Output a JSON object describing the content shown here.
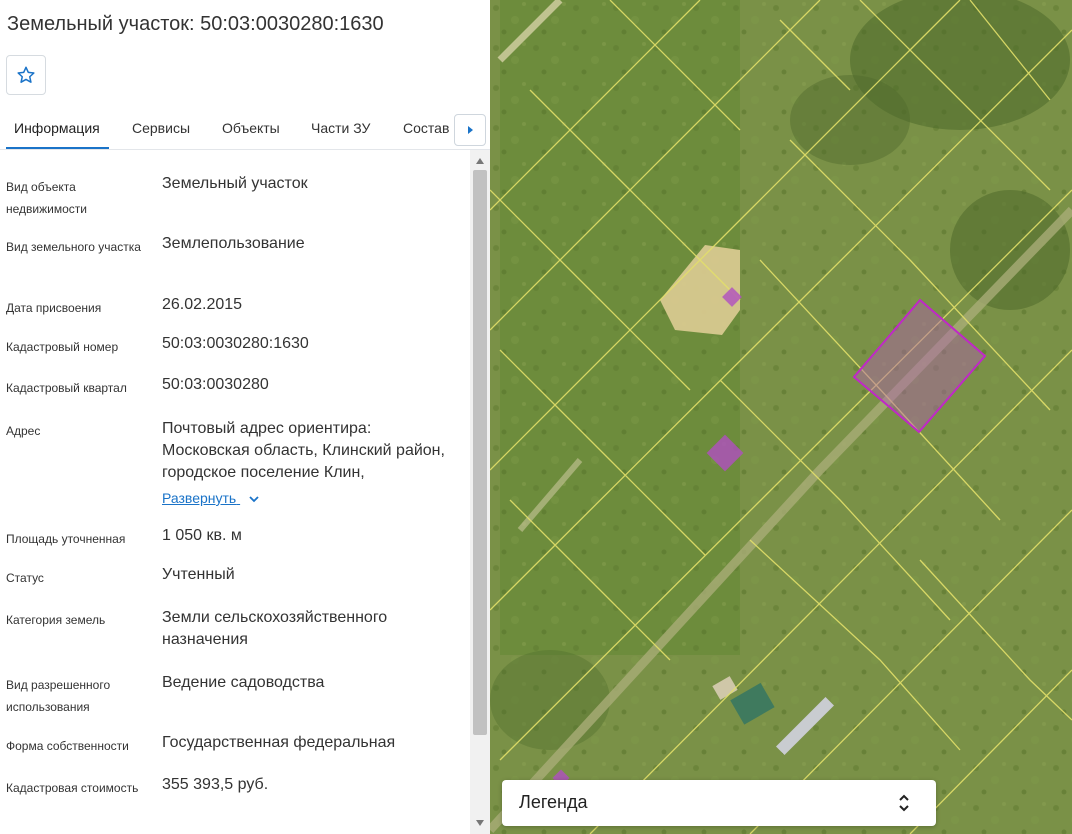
{
  "header": {
    "title": "Земельный участок: 50:03:0030280:1630"
  },
  "favorite": {
    "icon": "star-outline-icon"
  },
  "tabs": [
    {
      "label": "Информация",
      "active": true
    },
    {
      "label": "Сервисы",
      "active": false
    },
    {
      "label": "Объекты",
      "active": false
    },
    {
      "label": "Части ЗУ",
      "active": false
    },
    {
      "label": "Состав",
      "active": false
    }
  ],
  "tabs_more_icon": "caret-right-icon",
  "info": [
    {
      "label": "Вид объекта недвижимости",
      "value": "Земельный участок"
    },
    {
      "label": "Вид земельного участка",
      "value": "Землепользование"
    },
    {
      "label": "Дата присвоения",
      "value": "26.02.2015"
    },
    {
      "label": "Кадастровый номер",
      "value": "50:03:0030280:1630"
    },
    {
      "label": "Кадастровый квартал",
      "value": "50:03:0030280"
    },
    {
      "label": "Адрес",
      "value": "Почтовый адрес ориентира: Московская область, Клинский район, городское поселение Клин,",
      "expand_label": "Развернуть"
    },
    {
      "label": "Площадь уточненная",
      "value": "1 050 кв. м"
    },
    {
      "label": "Статус",
      "value": "Учтенный"
    },
    {
      "label": "Категория земель",
      "value": "Земли сельскохозяйственного назначения"
    },
    {
      "label": "Вид разрешенного использования",
      "value": "Ведение садоводства"
    },
    {
      "label": "Форма собственности",
      "value": "Государственная федеральная"
    },
    {
      "label": "Кадастровая стоимость",
      "value": "355 393,5 руб."
    }
  ],
  "map": {
    "legend_label": "Легенда",
    "colors": {
      "parcel_lines": "#e3e06a",
      "selected_parcel": "#b040c0",
      "field": "#6f8a3a"
    }
  }
}
